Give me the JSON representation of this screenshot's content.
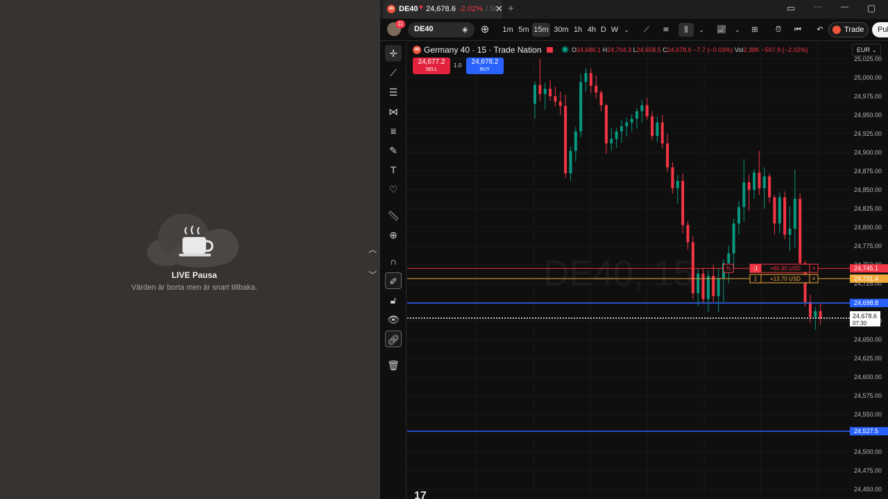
{
  "pause_panel": {
    "title": "LIVE Pausa",
    "subtitle": "Värden är borta men är snart tillbaka."
  },
  "tab": {
    "logo": "40",
    "symbol": "DE40",
    "arrow": "▼",
    "price": "24,678.6",
    "change": "-2.02%",
    "fade": "/ St",
    "close": "✕",
    "new_tab": "+"
  },
  "window": {
    "layout_icon": "▭",
    "more_icon": "···",
    "minimize": "—",
    "maximize": "▢"
  },
  "toolbar": {
    "avatar_badge": "11",
    "symbol": "DE40",
    "intervals": [
      "1m",
      "5m",
      "15m",
      "30m",
      "1h",
      "4h",
      "D",
      "W"
    ],
    "active_interval": "15m",
    "trade_label": "Trade",
    "publish_label": "Pub"
  },
  "legend": {
    "logo": "40",
    "title": "Germany 40 · 15 · Trade Nation",
    "o_label": "O",
    "o": "24,686.1",
    "h_label": "H",
    "h": "24,704.3",
    "l_label": "L",
    "l": "24,658.5",
    "c_label": "C",
    "c": "24,678.6",
    "chg": "−7.7 (−0.03%)",
    "vol_label": "Vol",
    "vol": "2.38K",
    "vol_chg": "−507.9 (−2.02%)"
  },
  "order_buttons": {
    "sell_price": "24,677.2",
    "sell_label": "SELL",
    "spread": "1.0",
    "buy_price": "24,678.2",
    "buy_label": "BUY"
  },
  "currency": "EUR",
  "watermark": "DE40, 15",
  "positions": [
    {
      "type": "stop",
      "qty": "-1",
      "pnl": "+65.90 USD",
      "price": "24,745.1",
      "color": "#f23645"
    },
    {
      "type": "entry",
      "qty": "1",
      "pnl": "+13.70 USD",
      "price": "24,731.4",
      "color": "#f2a93b"
    }
  ],
  "position_pct_label": "%",
  "levels": {
    "blue_upper": "24,698.8",
    "blue_lower": "24,527.5",
    "last_price": "24,678.6",
    "countdown": "07:30"
  },
  "colors": {
    "up": "#089981",
    "down": "#f23645",
    "blue": "#2962ff",
    "accent_orange": "#f2a93b"
  },
  "chart_data": {
    "type": "candlestick",
    "title": "Germany 40 · 15 · Trade Nation",
    "ylim": [
      24437,
      25048
    ],
    "y_ticks": [
      25025,
      25000,
      24975,
      24950,
      24925,
      24900,
      24875,
      24850,
      24825,
      24800,
      24775,
      24750,
      24725,
      24700,
      24675,
      24650,
      24625,
      24600,
      24575,
      24550,
      24525,
      24500,
      24475,
      24450
    ],
    "candles": [
      [
        24965,
        24995,
        24945,
        24990
      ],
      [
        24990,
        25025,
        24968,
        24978
      ],
      [
        24978,
        24993,
        24957,
        24985
      ],
      [
        24985,
        24996,
        24969,
        24975
      ],
      [
        24975,
        24988,
        24961,
        24968
      ],
      [
        24968,
        24981,
        24950,
        24962
      ],
      [
        24962,
        24977,
        24866,
        24872
      ],
      [
        24872,
        24908,
        24862,
        24902
      ],
      [
        24902,
        24934,
        24888,
        24928
      ],
      [
        24928,
        25005,
        24920,
        24994
      ],
      [
        24994,
        25012,
        24981,
        25006
      ],
      [
        25006,
        25012,
        24979,
        24989
      ],
      [
        24989,
        25003,
        24972,
        24980
      ],
      [
        24980,
        24983,
        24955,
        24963
      ],
      [
        24963,
        24965,
        24898,
        24912
      ],
      [
        24912,
        24933,
        24902,
        24918
      ],
      [
        24918,
        24933,
        24906,
        24928
      ],
      [
        24928,
        24944,
        24913,
        24935
      ],
      [
        24935,
        24946,
        24921,
        24940
      ],
      [
        24940,
        24951,
        24928,
        24945
      ],
      [
        24945,
        24959,
        24932,
        24955
      ],
      [
        24955,
        24970,
        24940,
        24963
      ],
      [
        24963,
        24973,
        24943,
        24948
      ],
      [
        24948,
        24955,
        24916,
        24922
      ],
      [
        24922,
        24948,
        24914,
        24940
      ],
      [
        24940,
        24950,
        24905,
        24912
      ],
      [
        24912,
        24925,
        24874,
        24880
      ],
      [
        24880,
        24887,
        24845,
        24852
      ],
      [
        24852,
        24870,
        24831,
        24862
      ],
      [
        24862,
        24872,
        24792,
        24803
      ],
      [
        24803,
        24808,
        24770,
        24780
      ],
      [
        24780,
        24788,
        24704,
        24712
      ],
      [
        24712,
        24745,
        24695,
        24738
      ],
      [
        24738,
        24745,
        24698,
        24704
      ],
      [
        24704,
        24742,
        24687,
        24735
      ],
      [
        24735,
        24750,
        24700,
        24708
      ],
      [
        24708,
        24745,
        24687,
        24732
      ],
      [
        24732,
        24757,
        24700,
        24752
      ],
      [
        24752,
        24775,
        24725,
        24765
      ],
      [
        24765,
        24812,
        24744,
        24805
      ],
      [
        24805,
        24835,
        24790,
        24827
      ],
      [
        24827,
        24891,
        24808,
        24860
      ],
      [
        24860,
        24870,
        24822,
        24850
      ],
      [
        24850,
        24878,
        24838,
        24873
      ],
      [
        24873,
        24902,
        24843,
        24852
      ],
      [
        24852,
        24880,
        24825,
        24868
      ],
      [
        24868,
        24872,
        24832,
        24840
      ],
      [
        24840,
        24843,
        24790,
        24805
      ],
      [
        24805,
        24846,
        24792,
        24840
      ],
      [
        24840,
        24848,
        24784,
        24790
      ],
      [
        24790,
        24828,
        24768,
        24798
      ],
      [
        24798,
        24877,
        24772,
        24838
      ],
      [
        24838,
        24845,
        24745,
        24752
      ],
      [
        24752,
        24755,
        24694,
        24700
      ],
      [
        24700,
        24710,
        24672,
        24680
      ],
      [
        24680,
        24694,
        24663,
        24688
      ],
      [
        24688,
        24698,
        24670,
        24678
      ]
    ],
    "horizontal_levels": [
      24745.1,
      24731.4,
      24698.8,
      24678.6,
      24527.5
    ]
  }
}
